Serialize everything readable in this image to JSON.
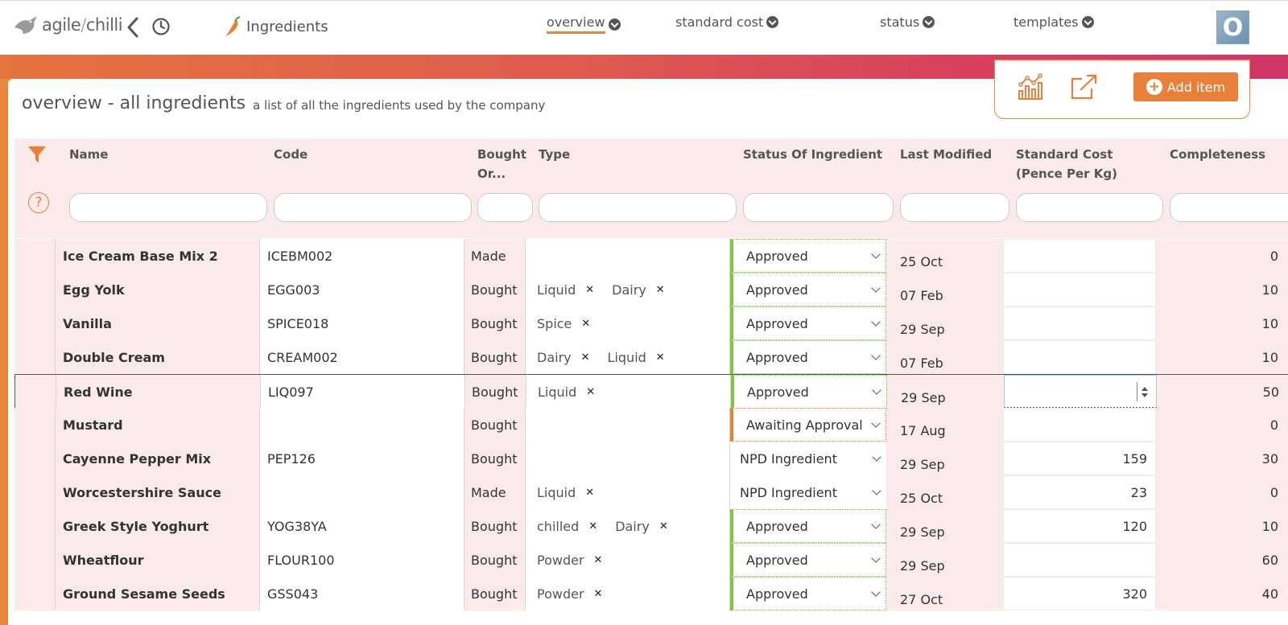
{
  "header": {
    "logo_text_left": "agile",
    "logo_text_sep": "/",
    "logo_text_right": "chilli",
    "module_title": "Ingredients",
    "nav": [
      {
        "label": "overview",
        "active": true
      },
      {
        "label": "standard cost",
        "active": false
      },
      {
        "label": "status",
        "active": false
      },
      {
        "label": "templates",
        "active": false
      }
    ],
    "avatar_letter": "O"
  },
  "page": {
    "title": "overview - all ingredients",
    "subtitle": "a list of all the ingredients used by the company",
    "add_label": "Add item"
  },
  "colors": {
    "accent": "#e8803a",
    "approved": "#7cc843",
    "row_tint": "#faeaea"
  },
  "columns": {
    "name": "Name",
    "code": "Code",
    "bought": "Bought Or...",
    "type": "Type",
    "status": "Status Of Ingredient",
    "modified": "Last Modified",
    "cost": "Standard Cost (Pence Per Kg)",
    "completeness": "Completeness"
  },
  "rows": [
    {
      "name": "Ice Cream Base Mix 2",
      "code": "ICEBM002",
      "bought": "Made",
      "tags": [],
      "status": "Approved",
      "status_kind": "approved",
      "modified": "25 Oct",
      "cost": "",
      "completeness": "0"
    },
    {
      "name": "Egg Yolk",
      "code": "EGG003",
      "bought": "Bought",
      "tags": [
        "Liquid",
        "Dairy"
      ],
      "status": "Approved",
      "status_kind": "approved",
      "modified": "07 Feb",
      "cost": "",
      "completeness": "10"
    },
    {
      "name": "Vanilla",
      "code": "SPICE018",
      "bought": "Bought",
      "tags": [
        "Spice"
      ],
      "status": "Approved",
      "status_kind": "approved",
      "modified": "29 Sep",
      "cost": "",
      "completeness": "10"
    },
    {
      "name": "Double Cream",
      "code": "CREAM002",
      "bought": "Bought",
      "tags": [
        "Dairy",
        "Liquid"
      ],
      "status": "Approved",
      "status_kind": "approved",
      "modified": "07 Feb",
      "cost": "",
      "completeness": "10"
    },
    {
      "name": "Red Wine",
      "code": "LIQ097",
      "bought": "Bought",
      "tags": [
        "Liquid"
      ],
      "status": "Approved",
      "status_kind": "approved",
      "modified": "29 Sep",
      "cost": "",
      "completeness": "50",
      "selected": true
    },
    {
      "name": "Mustard",
      "code": "",
      "bought": "Bought",
      "tags": [],
      "status": "Awaiting Approval",
      "status_kind": "awaiting",
      "modified": "17 Aug",
      "cost": "",
      "completeness": "0"
    },
    {
      "name": "Cayenne Pepper Mix",
      "code": "PEP126",
      "bought": "Bought",
      "tags": [],
      "status": "NPD Ingredient",
      "status_kind": "npd",
      "modified": "29 Sep",
      "cost": "159",
      "completeness": "30"
    },
    {
      "name": "Worcestershire Sauce",
      "code": "",
      "bought": "Made",
      "tags": [
        "Liquid"
      ],
      "status": "NPD Ingredient",
      "status_kind": "npd",
      "modified": "25 Oct",
      "cost": "23",
      "completeness": "0"
    },
    {
      "name": "Greek Style Yoghurt",
      "code": "YOG38YA",
      "bought": "Bought",
      "tags": [
        "chilled",
        "Dairy"
      ],
      "status": "Approved",
      "status_kind": "approved",
      "modified": "29 Sep",
      "cost": "120",
      "completeness": "10"
    },
    {
      "name": "Wheatflour",
      "code": "FLOUR100",
      "bought": "Bought",
      "tags": [
        "Powder"
      ],
      "status": "Approved",
      "status_kind": "approved",
      "modified": "29 Sep",
      "cost": "",
      "completeness": "60"
    },
    {
      "name": "Ground Sesame Seeds",
      "code": "GSS043",
      "bought": "Bought",
      "tags": [
        "Powder"
      ],
      "status": "Approved",
      "status_kind": "approved",
      "modified": "27 Oct",
      "cost": "320",
      "completeness": "40"
    }
  ]
}
